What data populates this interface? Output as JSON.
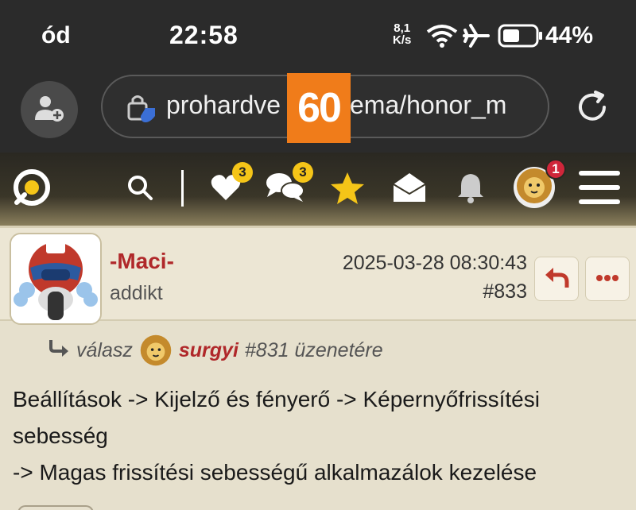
{
  "status_bar": {
    "left_text": "ód",
    "time": "22:58",
    "speed_value": "8,1",
    "speed_unit": "K/s",
    "battery_percent": "44%",
    "icons": [
      "wifi-icon",
      "airplane-icon",
      "battery-icon"
    ]
  },
  "browser": {
    "url": "prohardver.hu/tema/honor_m",
    "url_visible_prefix": "prohardve",
    "url_visible_suffix": "tema/honor_m",
    "overlay_text": "60",
    "overlay_color": "#f07c1a",
    "icons": [
      "profile-add-icon",
      "shield-lock-icon",
      "reload-icon"
    ]
  },
  "site_header": {
    "likes_badge": "3",
    "messages_badge": "3",
    "profile_badge": "1",
    "icons": [
      "site-logo-icon",
      "search-icon",
      "heart-icon",
      "chat-bubbles-icon",
      "star-icon",
      "mail-icon",
      "bell-icon",
      "avatar-lion",
      "hamburger-menu-icon"
    ]
  },
  "post": {
    "username": "-Maci-",
    "rank": "addikt",
    "date": "2025-03-28 08:30:43",
    "number": "#833",
    "reply_prefix": "válasz",
    "reply_user": "surgyi",
    "reply_suffix": "#831 üzenetére",
    "body_lines": [
      "Beállítások -> Kijelző és fényerő -> Képernyőfrissítési",
      "sebesség",
      "-> Magas frissítési sebességű alkalmazálok kezelése"
    ],
    "accent_color": "#b0282a"
  }
}
